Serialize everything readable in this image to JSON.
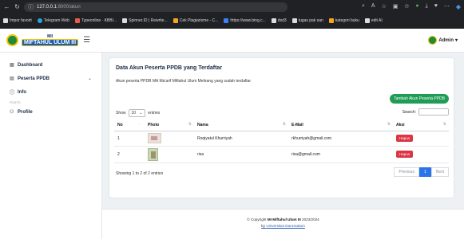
{
  "browser": {
    "url_host": "127.0.0.1",
    "url_path": ":8000/akun",
    "bookmarks": [
      "Impor favorit",
      "Telegram Web",
      "Typeonline · KBBI...",
      "Spinner.ID | Rewrite...",
      "Cek Plagiarisme - C...",
      "https://www.bing.c...",
      "dsd3",
      "tugas pak san",
      "kategori buku",
      "edit AI"
    ]
  },
  "header": {
    "brand_top": "MII",
    "brand_main": "MIFTAHUL ULUM III",
    "user_label": "Admin"
  },
  "sidebar": {
    "items": [
      {
        "label": "Dashboard"
      },
      {
        "label": "Peserta PPDB"
      },
      {
        "label": "Info"
      }
    ],
    "section_head": "POSTS",
    "profile_label": "Profile"
  },
  "content": {
    "title": "Data Akun Peserta PPDB yang Terdaftar",
    "subtitle": "Akun peserta PPDB MA Ma'arif Miftahul Ulum Melirang yang sudah terdaftar",
    "add_button": "Tambah Akun Peserta PPDB",
    "show_label": "Show",
    "entries_value": "10",
    "entries_label": "entries",
    "search_label": "Search:",
    "columns": [
      "No",
      "Photo",
      "Nama",
      "E-Mail",
      "Aksi"
    ],
    "rows": [
      {
        "no": "1",
        "nama": "Roqiyatul Khurriyah",
        "email": "rkhurriyah@gmail.com",
        "action": "Hapus"
      },
      {
        "no": "2",
        "nama": "risa",
        "email": "risa@gmail.com",
        "action": "Hapus"
      }
    ],
    "info": "Showing 1 to 2 of 2 entries",
    "pager": {
      "prev": "Previous",
      "current": "1",
      "next": "Next"
    }
  },
  "footer": {
    "copyright_prefix": "© Copyright",
    "copyright_strong": "MI Miftahul Ulum III",
    "copyright_year": "2023/2024",
    "by_prefix": "by",
    "by_link": "Universitas Darussalam"
  }
}
